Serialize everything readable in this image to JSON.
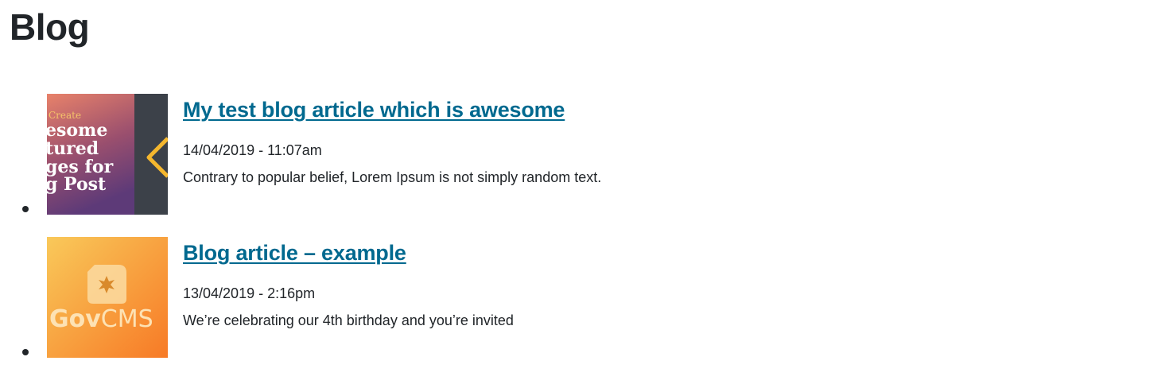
{
  "page": {
    "title": "Blog"
  },
  "articles": [
    {
      "title": "My test blog article which is awesome",
      "date": "14/04/2019 - 11:07am",
      "summary": "Contrary to popular belief, Lorem Ipsum is not simply random text.",
      "thumbnail": {
        "icon": "featured-image-thumbnail",
        "lines": [
          "Create",
          "esome",
          "tured",
          "ges for",
          "g Post"
        ],
        "colors": {
          "top": "#e8826a",
          "bottom": "#5d3a78",
          "side": "#3c4149",
          "accent": "#f5b72e"
        }
      }
    },
    {
      "title": "Blog article – example",
      "date": "13/04/2019 - 2:16pm",
      "summary": "We’re celebrating our 4th birthday and you’re invited",
      "thumbnail": {
        "icon": "govcms-logo-thumbnail",
        "logo_text_bold": "Gov",
        "logo_text_light": "CMS",
        "colors": {
          "top": "#f9c95a",
          "bottom": "#f77a26",
          "star": "#d98a2c"
        }
      }
    }
  ],
  "colors": {
    "link": "#00698f",
    "text": "#212529",
    "background": "#ffffff"
  }
}
